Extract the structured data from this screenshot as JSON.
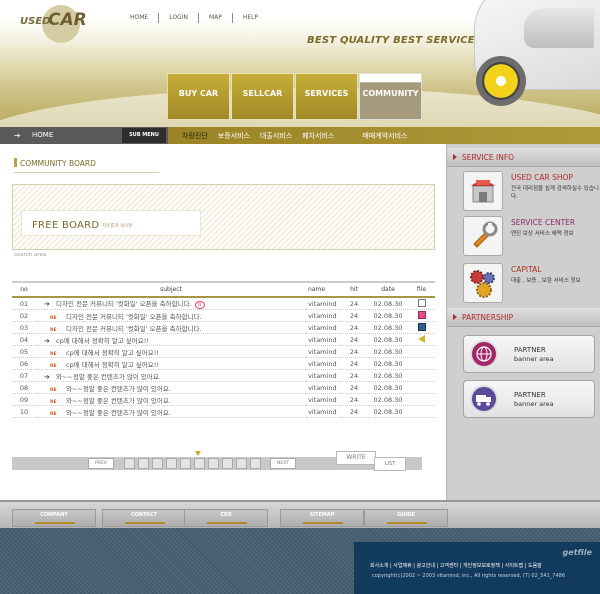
{
  "logo": {
    "used": "USED",
    "car": "CAR"
  },
  "top_links": [
    "HOME",
    "LOGIN",
    "MAP",
    "HELP"
  ],
  "tagline": "BEST QUALITY BEST SERVICE",
  "main_nav": [
    "BUY CAR",
    "SELLCAR",
    "SERVICES",
    "COMMUNITY"
  ],
  "breadcrumb": {
    "home": "HOME",
    "submenu": "SUB MENU"
  },
  "sub_menu": [
    "차량진단",
    "보증서비스",
    "대출서비스",
    "폐차서비스",
    "매매계약서비스"
  ],
  "board": {
    "title": "COMMUNITY BOARD",
    "banner_title": "FREE BOARD",
    "banner_sub": "자유롭게 게시판",
    "search_area": "search area",
    "columns": {
      "no": "no",
      "subject": "subject",
      "name": "name",
      "hit": "hit",
      "date": "date",
      "file": "file"
    },
    "rows": [
      {
        "no": "01",
        "marker": "arrow",
        "subject": "디자인 전문 커뮤니티 '컷화일' 오픈을 축하합니다.",
        "badge": "new",
        "name": "vitamind",
        "hit": "24",
        "date": "02.08.30",
        "file": "doc"
      },
      {
        "no": "02",
        "marker": "re",
        "subject": "디자인 전문 커뮤니티 '컷화일' 오픈을 축하합니다.",
        "name": "vitamind",
        "hit": "24",
        "date": "02.08.30",
        "file": "pink"
      },
      {
        "no": "03",
        "marker": "re",
        "subject": "디자인 전문 커뮤니티 '컷화일' 오픈을 축하합니다.",
        "name": "vitamind",
        "hit": "24",
        "date": "02.08.30",
        "file": "img"
      },
      {
        "no": "04",
        "marker": "arrow",
        "subject": "cp에 대해서 정확히 알고 싶어요!!",
        "name": "vitamind",
        "hit": "24",
        "date": "02.08.30",
        "file": "snd"
      },
      {
        "no": "05",
        "marker": "re",
        "subject": "cp에 대해서 정확히 알고 싶어요!!",
        "name": "vitamind",
        "hit": "24",
        "date": "02.08.30",
        "file": ""
      },
      {
        "no": "06",
        "marker": "re",
        "subject": "cp에 대해서 정확히 알고 싶어요!!",
        "name": "vitamind",
        "hit": "24",
        "date": "02.08.30",
        "file": ""
      },
      {
        "no": "07",
        "marker": "arrow",
        "subject": "와~~정말 좋은 컨텐츠가 많이 있어요.",
        "name": "vitamind",
        "hit": "24",
        "date": "02.08.30",
        "file": ""
      },
      {
        "no": "08",
        "marker": "re",
        "subject": "와~~정말 좋은 컨텐츠가 많이 있어요.",
        "name": "vitamind",
        "hit": "24",
        "date": "02.08.30",
        "file": ""
      },
      {
        "no": "09",
        "marker": "re",
        "subject": "와~~정말 좋은 컨텐츠가 많이 있어요.",
        "name": "vitamind",
        "hit": "24",
        "date": "02.08.30",
        "file": ""
      },
      {
        "no": "10",
        "marker": "re",
        "subject": "와~~정말 좋은 컨텐츠가 많이 있어요.",
        "name": "vitamind",
        "hit": "24",
        "date": "02.08.30",
        "file": ""
      }
    ],
    "re_label": "RE",
    "new_label": "N",
    "pager": {
      "prev": "PREV",
      "next": "NEXT",
      "write": "WRITE",
      "list": "LIST"
    }
  },
  "sidebar": {
    "service_info": "SERVICE INFO",
    "items": [
      {
        "title": "USED CAR SHOP",
        "desc": "전국 대리점을 쉽게 검색하실수 있습니다.",
        "color": "#b42a2a",
        "icon": "shop-icon"
      },
      {
        "title": "SERVICE CENTER",
        "desc": "엔진 보상 서비스 혜택 정보",
        "color": "#8a2d6b",
        "icon": "wrench-icon"
      },
      {
        "title": "CAPITAL",
        "desc": "대출 , 보증 , 보험 서비스 정보",
        "color": "#a7331f",
        "icon": "gears-icon"
      }
    ],
    "partnership": "PARTNERSHIP",
    "partners": [
      {
        "title": "PARTNER",
        "desc": "banner area",
        "color": "#a3286a",
        "icon": "globe-icon"
      },
      {
        "title": "PARTNER",
        "desc": "banner area",
        "color": "#5c4a9a",
        "icon": "truck-icon"
      }
    ]
  },
  "footer": {
    "links": [
      "COMPANY",
      "CONTACT",
      "CEO",
      "SITEMAP",
      "GUIDE"
    ],
    "brand": "getfile",
    "text_links": "회사소개 | 사업제휴 | 광고안내 | 고객센터 | 개인정보보호정책 | 사이트맵 | 도움말",
    "copyright": "copyright(c)2002 ~ 2003 vitamind, inc., All rights reserved, (T) 02_541_7486"
  }
}
